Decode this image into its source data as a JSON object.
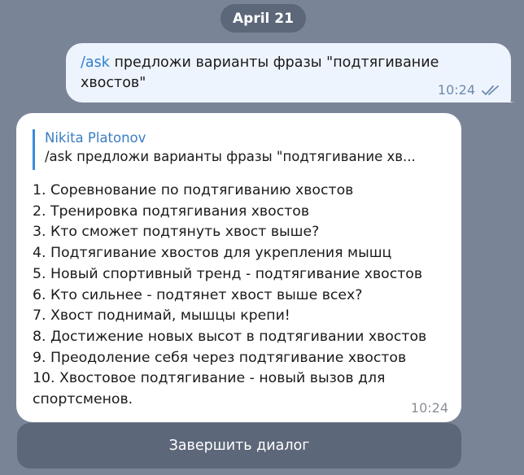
{
  "date_separator": "April 21",
  "outgoing_message": {
    "command": "/ask",
    "text": " предложи варианты фразы \"подтягивание хвостов\"",
    "time": "10:24",
    "status_icon": "double-check-icon"
  },
  "incoming_message": {
    "reply": {
      "author": "Nikita Platonov",
      "text": "/ask предложи варианты фразы \"подтягивание хв..."
    },
    "lines": [
      "1. Соревнование по подтягиванию хвостов",
      "2. Тренировка подтягивания хвостов",
      "3. Кто сможет подтянуть хвост выше?",
      "4. Подтягивание хвостов для укрепления мышц",
      "5. Новый спортивный тренд - подтягивание хвостов",
      "6. Кто сильнее - подтянет хвост выше всех?",
      "7. Хвост поднимай, мышцы крепи!",
      "8. Достижение новых высот в подтягивании хвостов",
      "9. Преодоление себя через подтягивание хвостов",
      "10. Хвостовое подтягивание - новый вызов для спортсменов."
    ],
    "time": "10:24"
  },
  "keyboard": {
    "button_label": "Завершить диалог"
  },
  "colors": {
    "background": "#7a8497",
    "outgoing_bubble": "#eef4fe",
    "incoming_bubble": "#ffffff",
    "accent": "#3a8bd8",
    "pill": "#5d677a"
  }
}
